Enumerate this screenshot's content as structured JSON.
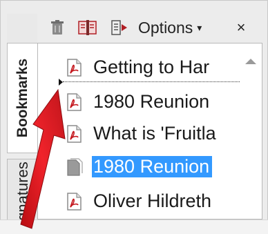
{
  "sidebar_tabs": {
    "bookmarks_label": "Bookmarks",
    "signatures_label": "gnatures"
  },
  "toolbar": {
    "delete_icon": "trash-icon",
    "new_bookmark_icon": "new-bookmark-icon",
    "expand_icon": "expand-bookmark-icon",
    "options_label": "Options",
    "options_caret": "▾",
    "close_label": "×"
  },
  "bookmarks": [
    {
      "label": "Getting to Har",
      "icon": "pdf-page-icon",
      "selected": false
    },
    {
      "label": "1980 Reunion",
      "icon": "pdf-page-icon",
      "selected": false
    },
    {
      "label": "What is 'Fruitla",
      "icon": "pdf-page-icon",
      "selected": false
    },
    {
      "label": "1980 Reunion",
      "icon": "blank-page-icon",
      "selected": true
    },
    {
      "label": "Oliver Hildreth",
      "icon": "pdf-page-icon",
      "selected": false
    }
  ],
  "colors": {
    "selection": "#3399ff",
    "arrow": "#e3141b",
    "pdf_icon": "#c4161c"
  }
}
